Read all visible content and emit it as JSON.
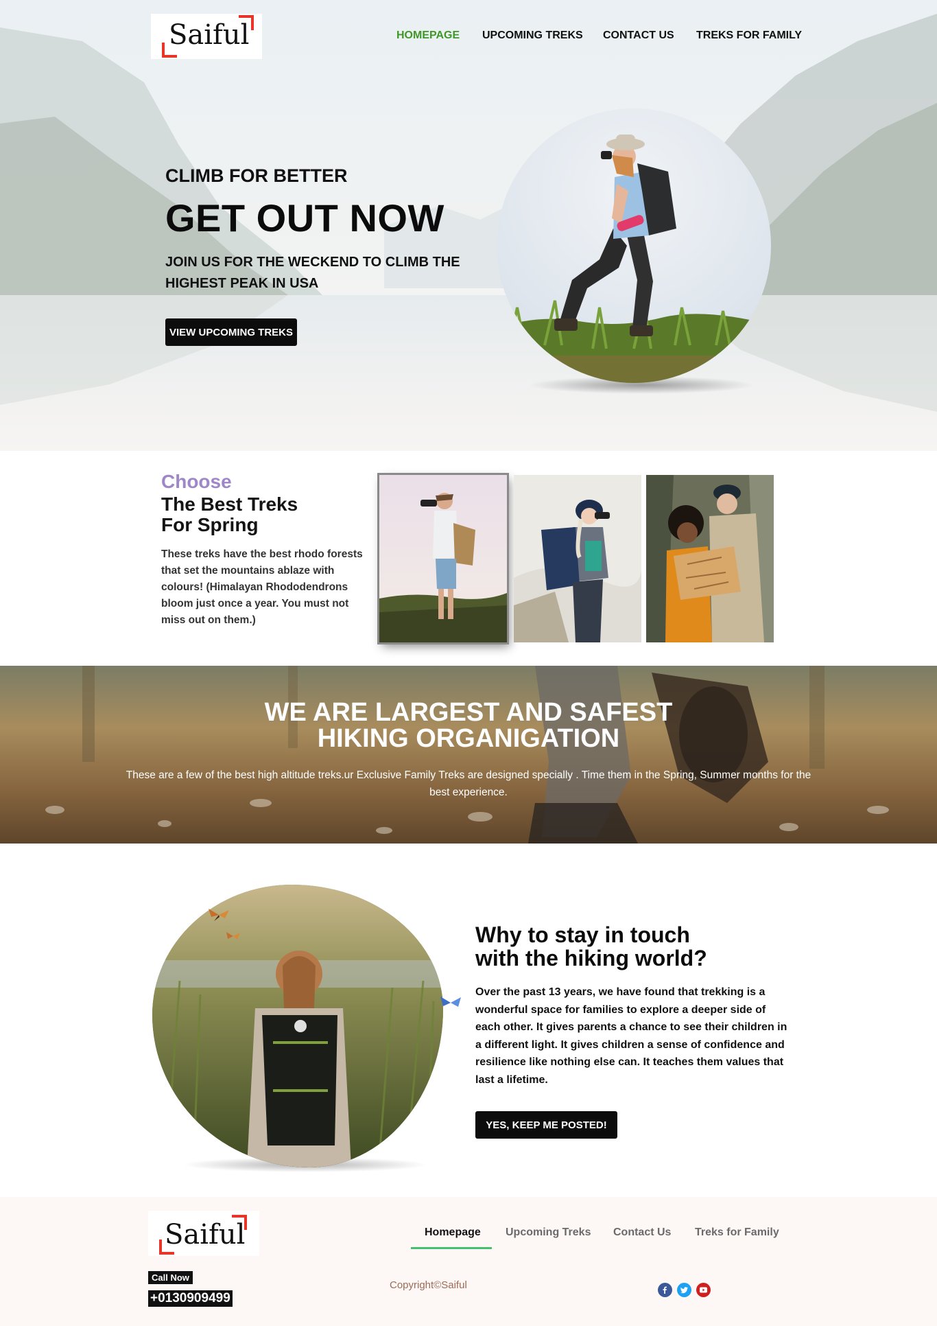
{
  "brand": {
    "logo_text": "Saiful",
    "accent_color": "#e8352a"
  },
  "nav": {
    "items": [
      {
        "label": "HOMEPAGE",
        "active": true
      },
      {
        "label": "UPCOMING TREKS",
        "active": false
      },
      {
        "label": "CONTACT US",
        "active": false
      },
      {
        "label": "TREKS FOR FAMILY",
        "active": false
      }
    ],
    "active_color": "#3f9728"
  },
  "hero": {
    "subtitle": "CLIMB FOR BETTER",
    "title": "GET OUT NOW",
    "description": "JOIN US FOR THE WECKEND TO CLIMB THE HIGHEST PEAK IN USA",
    "cta_label": "VIEW UPCOMING TREKS"
  },
  "choose": {
    "kicker": "Choose",
    "title_line1": "The Best Treks",
    "title_line2": "For Spring",
    "text": "These treks have the best rhodo forests that set the mountains ablaze with colours! (Himalayan Rhododendrons bloom just once a year. You must not miss out on them.)",
    "kicker_color": "#9f86c9"
  },
  "banner": {
    "title_line1": "WE ARE LARGEST AND SAFEST",
    "title_line2": "HIKING ORGANIGATION",
    "text": "These are a few of the best high altitude treks.ur Exclusive Family Treks are designed specially . Time them in the Spring, Summer months for the best experience."
  },
  "why": {
    "title_line1": "Why to stay in touch",
    "title_line2": "with the hiking world?",
    "text": "Over the past 13 years, we have found that trekking is a wonderful space for families to explore a deeper side of each other. It gives parents a chance to see their children in a different light. It gives children a sense of confidence and resilience like nothing else can. It teaches them values that last a lifetime.",
    "cta_label": "YES, KEEP ME POSTED!"
  },
  "footer": {
    "logo_text": "Saiful",
    "nav": [
      {
        "label": "Homepage",
        "active": true
      },
      {
        "label": "Upcoming Treks",
        "active": false
      },
      {
        "label": "Contact Us",
        "active": false
      },
      {
        "label": "Treks for Family",
        "active": false
      }
    ],
    "call_label": "Call Now",
    "phone": "+0130909499",
    "copyright": "Copyright©Saiful",
    "social": [
      {
        "icon": "facebook-icon",
        "color": "#3b5998"
      },
      {
        "icon": "twitter-icon",
        "color": "#1da1f2"
      },
      {
        "icon": "youtube-icon",
        "color": "#cd201f"
      }
    ],
    "underline_color": "#44c16e"
  }
}
